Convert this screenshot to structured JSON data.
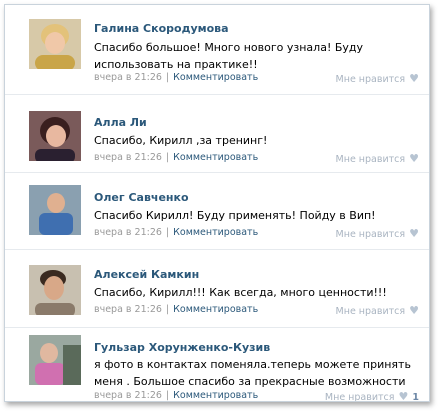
{
  "comments": [
    {
      "author": "Галина Скородумова",
      "text": "Спасибо большое! Много нового узнала! Буду использовать на практике!!",
      "time": "вчера в 21:26",
      "reply": "Комментировать",
      "like": "Мне нравится",
      "like_count": "",
      "avatar_icon": "avatar-photo-woman-blonde"
    },
    {
      "author": "Алла Ли",
      "text": "Спасибо, Кирилл ,за тренинг!",
      "time": "вчера в 21:26",
      "reply": "Комментировать",
      "like": "Мне нравится",
      "like_count": "",
      "avatar_icon": "avatar-photo-woman-dark-hair"
    },
    {
      "author": "Олег Савченко",
      "text": "Спасибо Кирилл! Буду применять! Пойду в Вип!",
      "time": "вчера в 21:26",
      "reply": "Комментировать",
      "like": "Мне нравится",
      "like_count": "",
      "avatar_icon": "avatar-photo-man-blue-shirt"
    },
    {
      "author": "Алексей Камкин",
      "text": "Спасибо, Кирилл!!! Как всегда, много ценности!!!",
      "time": "вчера в 21:26",
      "reply": "Комментировать",
      "like": "Мне нравится",
      "like_count": "",
      "avatar_icon": "avatar-photo-man-smiling"
    },
    {
      "author": "Гульзар Хорунженко-Кузив",
      "text": "я фото в контактах поменяла.теперь можете принять меня . Большое спасибо за прекрасные возможности",
      "time": "вчера в 21:26",
      "reply": "Комментировать",
      "like": "Мне нравится",
      "like_count": "1",
      "avatar_icon": "avatar-photo-woman-pink"
    }
  ],
  "colors": {
    "author": "#2b587a",
    "meta": "#999999",
    "like": "#a9b4c1",
    "border": "#e6eaee"
  }
}
